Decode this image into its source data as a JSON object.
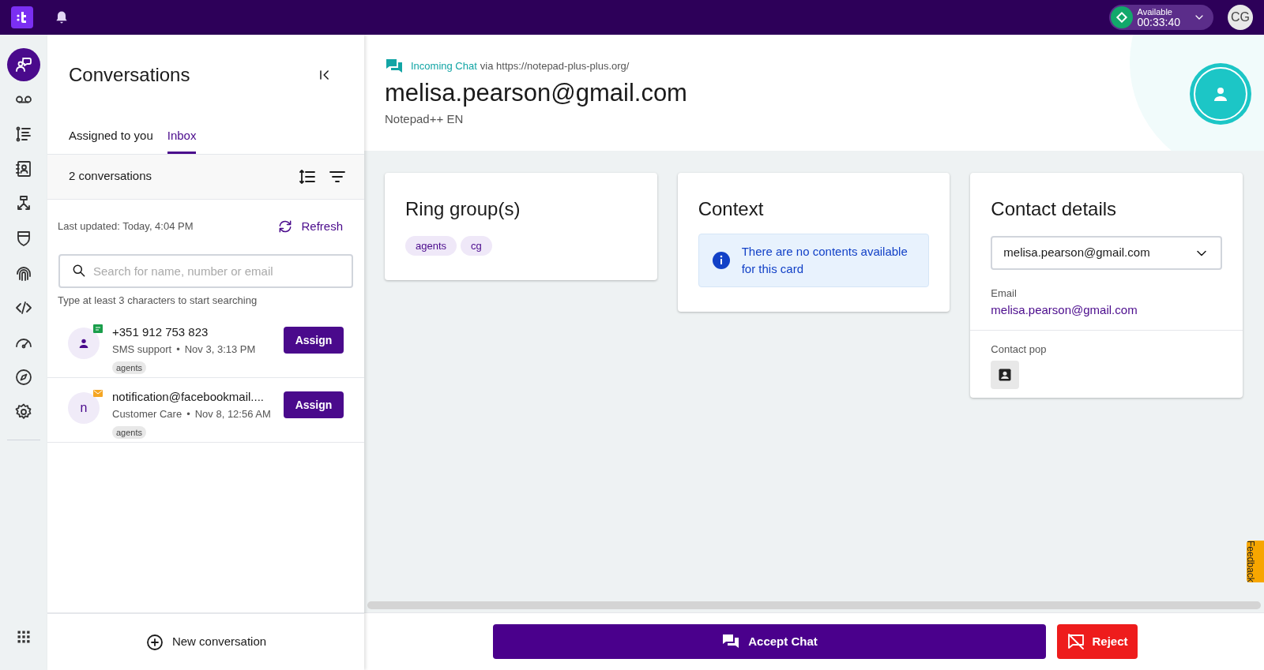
{
  "topbar": {
    "status": {
      "label": "Available",
      "timer": "00:33:40"
    },
    "avatar_initials": "CG"
  },
  "nav": {
    "items": [
      {
        "selected": true
      },
      {
        "selected": false
      },
      {
        "selected": false
      },
      {
        "selected": false
      },
      {
        "selected": false
      },
      {
        "selected": false
      },
      {
        "selected": false
      },
      {
        "selected": false
      },
      {
        "selected": false
      },
      {
        "selected": false
      },
      {
        "selected": false
      }
    ]
  },
  "conversations": {
    "title": "Conversations",
    "tabs": [
      {
        "label": "Assigned to you",
        "selected": false
      },
      {
        "label": "Inbox",
        "selected": true
      }
    ],
    "count": "2 conversations",
    "last_updated": "Last updated: Today, 4:04 PM",
    "refresh": "Refresh",
    "search": {
      "placeholder": "Search for name, number or email",
      "hint": "Type at least 3 characters to start searching"
    },
    "items": [
      {
        "kind": "sms",
        "name": "+351 912 753 823",
        "channel": "SMS support",
        "separator": "•",
        "time": "Nov 3, 3:13 PM",
        "tag": "agents",
        "button": "Assign"
      },
      {
        "kind": "email",
        "avatar_letter": "n",
        "name": "notification@facebookmail....",
        "channel": "Customer Care",
        "separator": "•",
        "time": "Nov 8, 12:56 AM",
        "tag": "agents",
        "button": "Assign"
      }
    ],
    "new_conversation": "New conversation"
  },
  "header": {
    "channel": "Incoming Chat",
    "via": "via https://notepad-plus-plus.org/",
    "contact": "melisa.pearson@gmail.com",
    "subtitle": "Notepad++ EN"
  },
  "cards": {
    "ring_groups": {
      "title": "Ring group(s)",
      "tags": [
        "agents",
        "cg"
      ]
    },
    "context": {
      "title": "Context",
      "message": "There are no contents available for this card"
    },
    "contact_details": {
      "title": "Contact details",
      "select": "melisa.pearson@gmail.com",
      "email_label": "Email",
      "email": "melisa.pearson@gmail.com",
      "contact_pop_label": "Contact pop"
    }
  },
  "actions": {
    "accept": "Accept Chat",
    "reject": "Reject"
  },
  "feedback": "Feedback"
}
